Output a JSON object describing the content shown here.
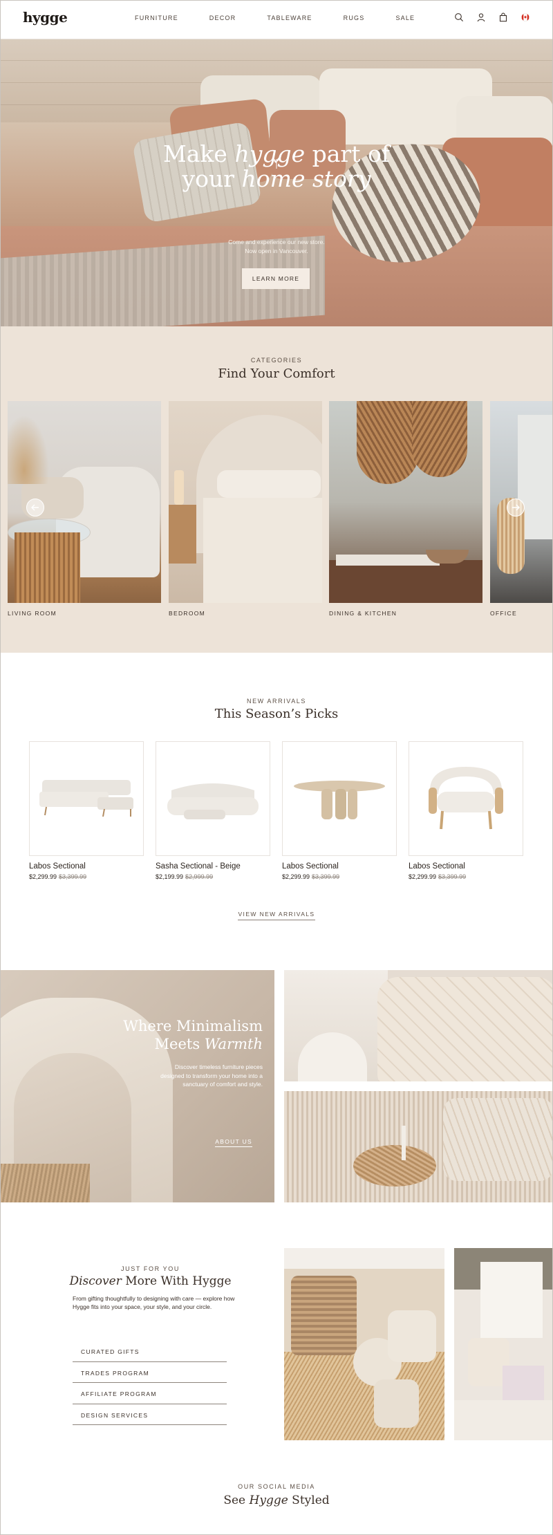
{
  "header": {
    "logo": "hygge",
    "nav": [
      "FURNITURE",
      "DECOR",
      "TABLEWARE",
      "RUGS",
      "SALE"
    ],
    "icons": [
      "search-icon",
      "user-icon",
      "bag-icon",
      "canada-flag-icon"
    ]
  },
  "hero": {
    "title_line1_a": "Make ",
    "title_line1_b": "hygge",
    "title_line1_c": " part of",
    "title_line2_a": "your ",
    "title_line2_b": "home story",
    "subtitle_line1": "Come and experience our new store.",
    "subtitle_line2": "Now open in Vancouver.",
    "button": "LEARN MORE"
  },
  "categories": {
    "eyebrow": "CATEGORIES",
    "title": "Find Your Comfort",
    "items": [
      "LIVING ROOM",
      "BEDROOM",
      "DINING & KITCHEN",
      "OFFICE"
    ]
  },
  "new_arrivals": {
    "eyebrow": "NEW ARRIVALS",
    "title": "This Season’s Picks",
    "products": [
      {
        "name": "Labos Sectional",
        "price": "$2,299.99",
        "was": "$3,399.99"
      },
      {
        "name": "Sasha Sectional - Beige",
        "price": "$2,199.99",
        "was": "$2,999.99"
      },
      {
        "name": "Labos Sectional",
        "price": "$2,299.99",
        "was": "$3,399.99"
      },
      {
        "name": "Labos Sectional",
        "price": "$2,299.99",
        "was": "$3,399.99"
      }
    ],
    "view_link": "VIEW NEW ARRIVALS"
  },
  "minimalism": {
    "title_line1": "Where Minimalism",
    "title_line2_a": "Meets ",
    "title_line2_b": "Warmth",
    "text": "Discover timeless furniture pieces designed to transform your home into a sanctuary of comfort and style.",
    "link": "ABOUT US"
  },
  "discover": {
    "eyebrow": "JUST FOR YOU",
    "title_a": "Discover",
    "title_b": " More With Hygge",
    "text": "From gifting thoughtfully to designing with care — explore how Hygge fits into your space, your style, and your circle.",
    "links": [
      "CURATED GIFTS",
      "TRADES PROGRAM",
      "AFFILIATE PROGRAM",
      "DESIGN SERVICES"
    ]
  },
  "social": {
    "eyebrow": "OUR SOCIAL MEDIA",
    "title_a": "See ",
    "title_b": "Hygge",
    "title_c": " Styled"
  },
  "colors": {
    "accent": "#3a2f28",
    "section_bg": "#ede3d8",
    "hero_button": "#f4ece4"
  }
}
